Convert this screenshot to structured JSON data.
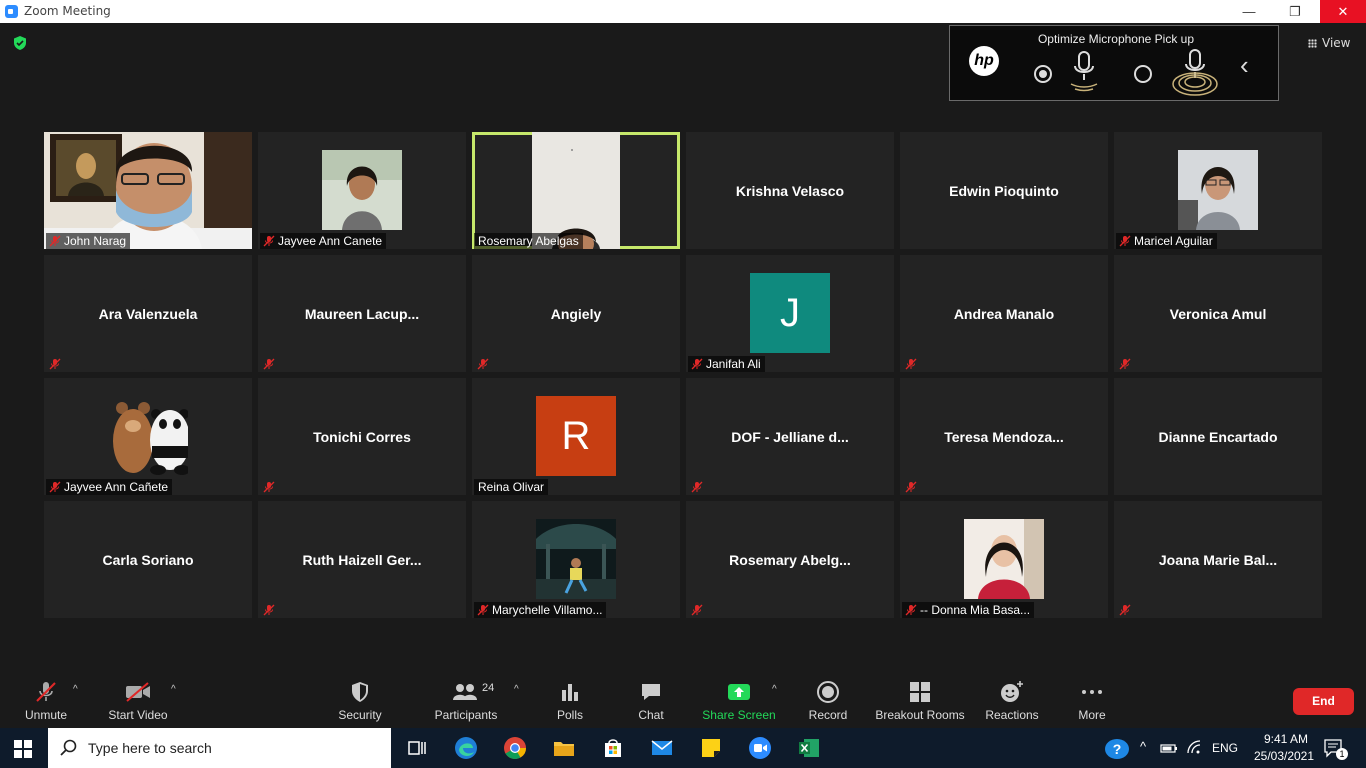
{
  "window": {
    "title": "Zoom Meeting",
    "minimize": "—",
    "maximize": "❐",
    "close": "✕"
  },
  "view_label": "View",
  "hp_panel": {
    "title": "Optimize Microphone Pick up",
    "logo": "hp"
  },
  "tiles": [
    {
      "name": "John Narag",
      "type": "photo",
      "muted": true,
      "photo": "mona"
    },
    {
      "name": "Jayvee Ann Canete",
      "type": "photo",
      "muted": true,
      "photo": "woman1"
    },
    {
      "name": "Rosemary Abelgas",
      "type": "photo",
      "muted": false,
      "photo": "wall",
      "active": true
    },
    {
      "name": "Krishna Velasco",
      "type": "name",
      "muted": false
    },
    {
      "name": "Edwin Pioquinto",
      "type": "name",
      "muted": false
    },
    {
      "name": "Maricel Aguilar",
      "type": "photo",
      "muted": true,
      "photo": "woman2"
    },
    {
      "name": "Ara Valenzuela",
      "type": "name",
      "muted": true
    },
    {
      "name": "Maureen  Lacup...",
      "type": "name",
      "muted": true
    },
    {
      "name": "Angiely",
      "type": "name",
      "muted": true
    },
    {
      "name": "Janifah Ali",
      "type": "avatar",
      "initial": "J",
      "color": "#0f8a7e",
      "muted": true
    },
    {
      "name": "Andrea Manalo",
      "type": "name",
      "muted": true
    },
    {
      "name": "Veronica Amul",
      "type": "name",
      "muted": true
    },
    {
      "name": "Jayvee Ann Cañete",
      "type": "photo",
      "muted": true,
      "photo": "bears"
    },
    {
      "name": "Tonichi Corres",
      "type": "name",
      "muted": true
    },
    {
      "name": "Reina Olivar",
      "type": "avatar",
      "initial": "R",
      "color": "#c73e12",
      "muted": false
    },
    {
      "name": "DOF - Jelliane d...",
      "type": "name",
      "muted": true
    },
    {
      "name": "Teresa  Mendoza...",
      "type": "name",
      "muted": true
    },
    {
      "name": "Dianne Encartado",
      "type": "name",
      "muted": false
    },
    {
      "name": "Carla Soriano",
      "type": "name",
      "muted": false
    },
    {
      "name": "Ruth  Haizell Ger...",
      "type": "name",
      "muted": true
    },
    {
      "name": "Marychelle Villamo...",
      "type": "photo",
      "muted": true,
      "photo": "night"
    },
    {
      "name": "Rosemary  Abelg...",
      "type": "name",
      "muted": true
    },
    {
      "name": "-- Donna Mia Basa...",
      "type": "photo",
      "muted": true,
      "photo": "woman3"
    },
    {
      "name": "Joana Marie Bal...",
      "type": "name",
      "muted": true
    }
  ],
  "toolbar": {
    "unmute": "Unmute",
    "start_video": "Start Video",
    "security": "Security",
    "participants": "Participants",
    "participants_count": "24",
    "polls": "Polls",
    "chat": "Chat",
    "share_screen": "Share Screen",
    "record": "Record",
    "breakout": "Breakout Rooms",
    "reactions": "Reactions",
    "more": "More",
    "end": "End",
    "share_color": "#23d959",
    "end_color": "#e02828"
  },
  "taskbar": {
    "search_placeholder": "Type here to search",
    "lang": "ENG",
    "time": "9:41 AM",
    "date": "25/03/2021",
    "notifications": "1",
    "help": "?"
  }
}
